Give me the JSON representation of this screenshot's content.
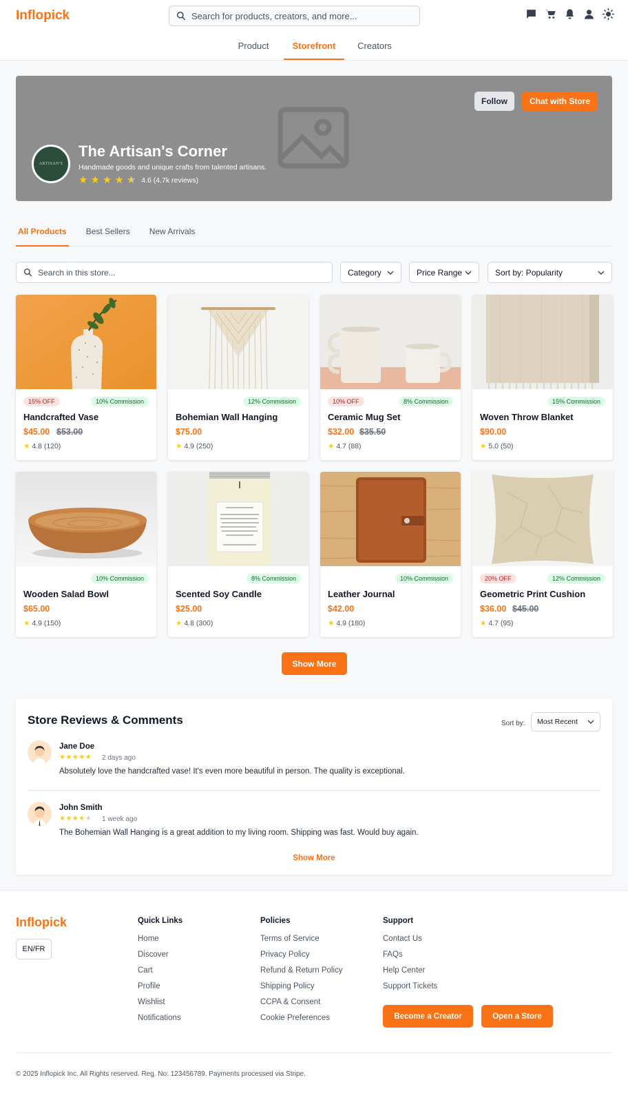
{
  "header": {
    "logo": "Inflopick",
    "search_placeholder": "Search for products, creators, and more...",
    "icons": [
      "chat-icon",
      "cart-icon",
      "bell-icon",
      "user-icon",
      "sun-icon"
    ],
    "nav": [
      "Product",
      "Storefront",
      "Creators"
    ],
    "active_nav": "Storefront"
  },
  "store": {
    "name": "The Artisan's Corner",
    "description": "Handmade goods and unique crafts from talented artisans.",
    "rating_text": "4.6 (4.7k reviews)",
    "stars": 4.5,
    "follow_label": "Follow",
    "chat_label": "Chat with Store",
    "avatar_text": "ARTISAN'S"
  },
  "store_tabs": [
    "All Products",
    "Best Sellers",
    "New Arrivals"
  ],
  "filters": {
    "search_placeholder": "Search in this store...",
    "category": "Category",
    "price_range": "Price Range",
    "sort": "Sort by: Popularity"
  },
  "products": [
    {
      "name": "Handcrafted Vase",
      "price": "$45.00",
      "old_price": "$53.00",
      "discount": "15% OFF",
      "commission": "10% Commission",
      "rating": "4.8 (120)"
    },
    {
      "name": "Bohemian Wall Hanging",
      "price": "$75.00",
      "old_price": "",
      "discount": "",
      "commission": "12% Commission",
      "rating": "4.9 (250)"
    },
    {
      "name": "Ceramic Mug Set",
      "price": "$32.00",
      "old_price": "$35.50",
      "discount": "10% OFF",
      "commission": "8% Commission",
      "rating": "4.7 (88)"
    },
    {
      "name": "Woven Throw Blanket",
      "price": "$90.00",
      "old_price": "",
      "discount": "",
      "commission": "15% Commission",
      "rating": "5.0 (50)"
    },
    {
      "name": "Wooden Salad Bowl",
      "price": "$65.00",
      "old_price": "",
      "discount": "",
      "commission": "10% Commission",
      "rating": "4.9 (150)"
    },
    {
      "name": "Scented Soy Candle",
      "price": "$25.00",
      "old_price": "",
      "discount": "",
      "commission": "8% Commission",
      "rating": "4.8 (300)"
    },
    {
      "name": "Leather Journal",
      "price": "$42.00",
      "old_price": "",
      "discount": "",
      "commission": "10% Commission",
      "rating": "4.9 (180)"
    },
    {
      "name": "Geometric Print Cushion",
      "price": "$36.00",
      "old_price": "$45.00",
      "discount": "20% OFF",
      "commission": "12% Commission",
      "rating": "4.7 (95)"
    }
  ],
  "show_more_label": "Show More",
  "reviews": {
    "title": "Store Reviews & Comments",
    "sort_label": "Sort by:",
    "sort_value": "Most Recent",
    "items": [
      {
        "name": "Jane Doe",
        "stars": 5,
        "time": "2 days ago",
        "text": "Absolutely love the handcrafted vase! It's even more beautiful in person. The quality is exceptional."
      },
      {
        "name": "John Smith",
        "stars": 4,
        "time": "1 week ago",
        "text": "The Bohemian Wall Hanging is a great addition to my living room. Shipping was fast. Would buy again."
      }
    ],
    "show_more_label": "Show More"
  },
  "footer": {
    "logo": "Inflopick",
    "lang": "EN/FR",
    "columns": [
      {
        "title": "Quick Links",
        "links": [
          "Home",
          "Discover",
          "Cart",
          "Profile",
          "Wishlist",
          "Notifications"
        ]
      },
      {
        "title": "Policies",
        "links": [
          "Terms of Service",
          "Privacy Policy",
          "Refund & Return Policy",
          "Shipping Policy",
          "CCPA & Consent",
          "Cookie Preferences"
        ]
      },
      {
        "title": "Support",
        "links": [
          "Contact Us",
          "FAQs",
          "Help Center",
          "Support Tickets"
        ]
      }
    ],
    "become_creator_label": "Become a Creator",
    "open_store_label": "Open a Store",
    "copyright": "© 2025 Inflopick Inc. All Rights reserved. Reg. No: 123456789. Payments processed via Stripe."
  },
  "colors": {
    "accent": "#f97316",
    "star": "#facc15"
  }
}
